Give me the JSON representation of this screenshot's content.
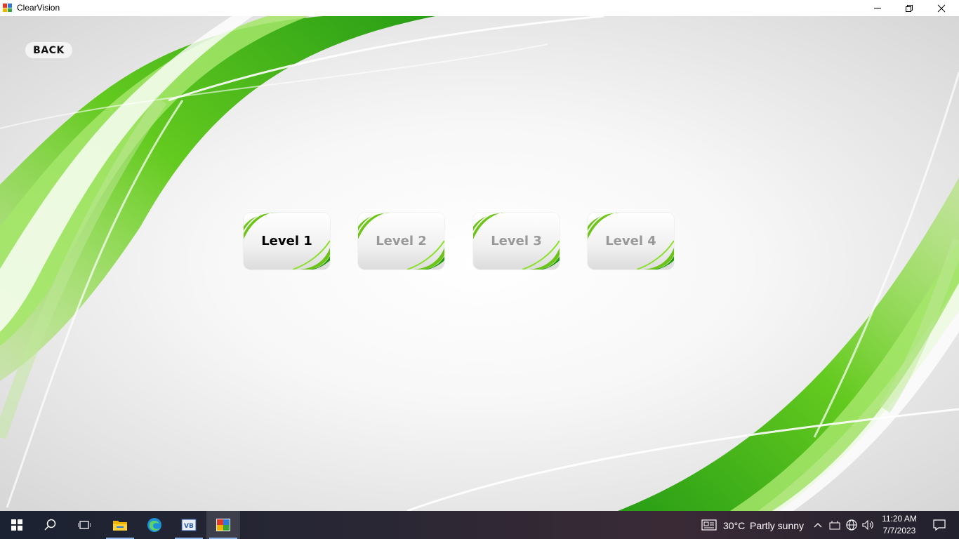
{
  "window": {
    "title": "ClearVision"
  },
  "app": {
    "back_label": "BACK",
    "levels": [
      {
        "label": "Level 1",
        "state": "unlocked"
      },
      {
        "label": "Level 2",
        "state": "locked"
      },
      {
        "label": "Level 3",
        "state": "locked"
      },
      {
        "label": "Level 4",
        "state": "locked"
      }
    ]
  },
  "taskbar": {
    "apps": [
      "start-icon",
      "search-icon",
      "task-view-icon",
      "file-explorer-icon",
      "edge-icon",
      "visual-basic-icon",
      "clearvision-app-icon"
    ],
    "weather": {
      "temp": "30°C",
      "condition": "Partly sunny"
    },
    "clock": {
      "time": "11:20 AM",
      "date": "7/7/2023"
    }
  },
  "colors": {
    "accent_green": "#6cc417",
    "dark_green": "#1e9a0b",
    "locked_text": "#999999"
  }
}
